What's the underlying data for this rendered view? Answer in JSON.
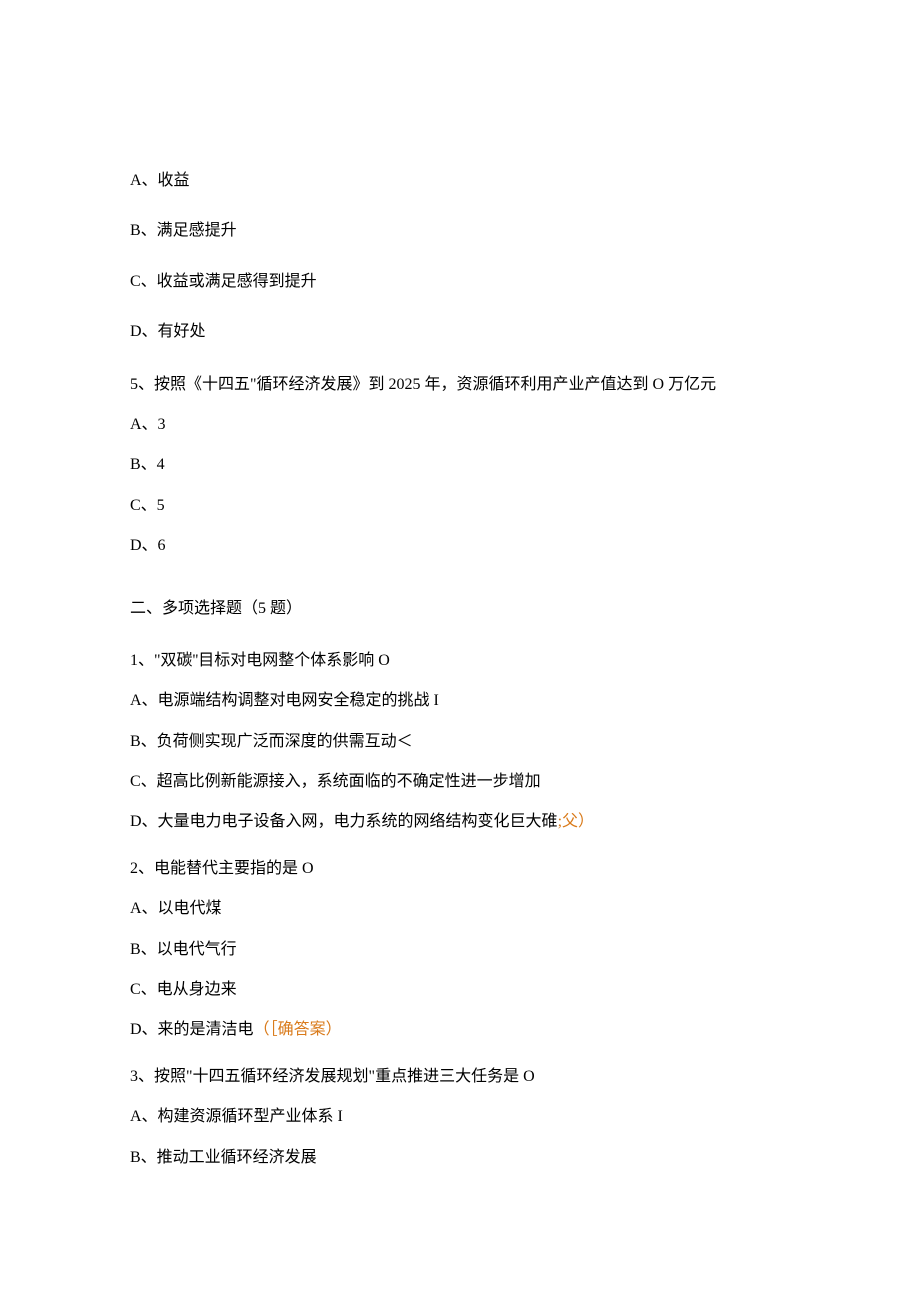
{
  "q4": {
    "A": "A、收益",
    "B": "B、满足感提升",
    "C": "C、收益或满足感得到提升",
    "D": "D、有好处"
  },
  "q5": {
    "text": "5、按照《十四五\"循环经济发展》到 2025 年，资源循环利用产业产值达到 O 万亿元",
    "A": "A、3",
    "B": "B、4",
    "C": "C、5",
    "D": "D、6"
  },
  "section2": "二、多项选择题（5 题）",
  "m1": {
    "text": "1、\"双碳''目标对电网整个体系影响 O",
    "A": "A、电源端结构调整对电网安全稳定的挑战 I",
    "B": "B、负荷侧实现广泛而深度的供需互动＜",
    "C": "C、超高比例新能源接入，系统面临的不确定性进一步增加",
    "D_pre": "D、大量电力电子设备入网，电力系统的网络结构变化巨大碓",
    "D_ans": ";父）"
  },
  "m2": {
    "text": "2、电能替代主要指的是 O",
    "A": "A、以电代煤",
    "B": "B、以电代气行",
    "C": "C、电从身边来",
    "D_pre": "D、来的是清洁电",
    "D_ans": "（［确答案）"
  },
  "m3": {
    "text": "3、按照\"十四五循环经济发展规划\"重点推进三大任务是 O",
    "A": "A、构建资源循环型产业体系 I",
    "B": "B、推动工业循环经济发展"
  }
}
